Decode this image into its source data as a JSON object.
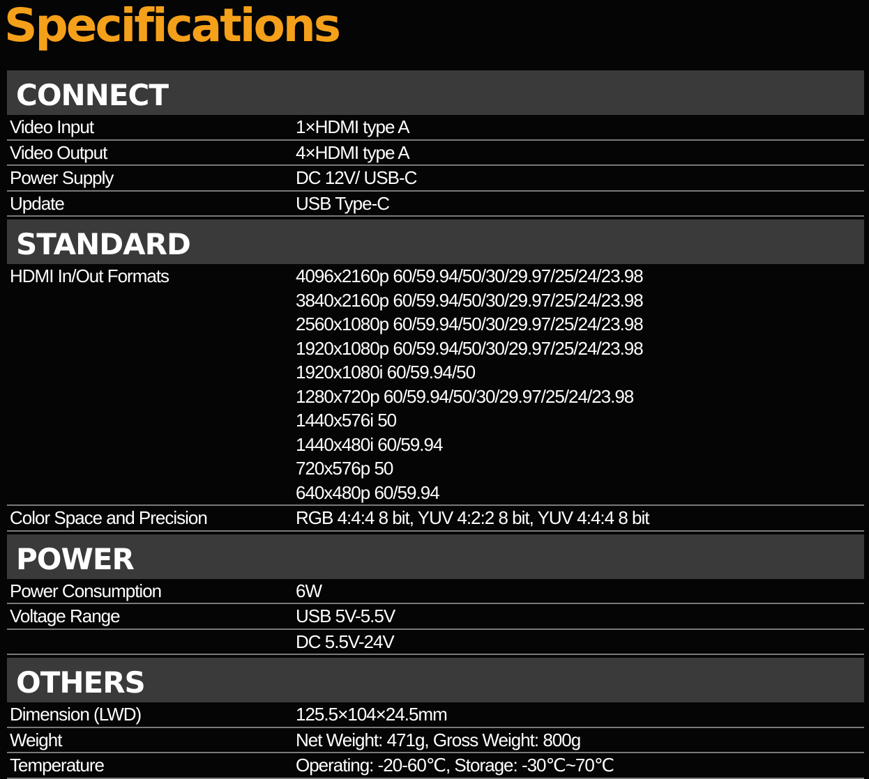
{
  "page": {
    "title": "Specifications",
    "accent_color": "#f5a01a",
    "header_bg": "#3a3a3a",
    "background": "#050505"
  },
  "sections": [
    {
      "title": "CONNECT",
      "rows": [
        {
          "label": "Video Input",
          "values": [
            "1×HDMI type A"
          ]
        },
        {
          "label": "Video Output",
          "values": [
            "4×HDMI type A"
          ]
        },
        {
          "label": "Power Supply",
          "values": [
            "DC 12V/ USB-C"
          ]
        },
        {
          "label": "Update",
          "values": [
            "USB Type-C"
          ]
        }
      ]
    },
    {
      "title": "STANDARD",
      "rows": [
        {
          "label": "HDMI In/Out Formats",
          "values": [
            "4096x2160p 60/59.94/50/30/29.97/25/24/23.98",
            "3840x2160p 60/59.94/50/30/29.97/25/24/23.98",
            "2560x1080p 60/59.94/50/30/29.97/25/24/23.98",
            "1920x1080p 60/59.94/50/30/29.97/25/24/23.98",
            "1920x1080i 60/59.94/50",
            "1280x720p 60/59.94/50/30/29.97/25/24/23.98",
            "1440x576i 50",
            "1440x480i 60/59.94",
            "720x576p 50",
            "640x480p 60/59.94"
          ]
        },
        {
          "label": "Color Space and Precision",
          "values": [
            "RGB 4:4:4 8 bit, YUV 4:2:2 8 bit, YUV 4:4:4 8 bit"
          ]
        }
      ]
    },
    {
      "title": "POWER",
      "rows": [
        {
          "label": "Power Consumption",
          "values": [
            "6W"
          ]
        },
        {
          "label": "Voltage Range",
          "values": [
            "USB 5V-5.5V"
          ]
        },
        {
          "label": "",
          "values": [
            "DC 5.5V-24V"
          ]
        }
      ]
    },
    {
      "title": "OTHERS",
      "rows": [
        {
          "label": "Dimension (LWD)",
          "values": [
            "125.5×104×24.5mm"
          ]
        },
        {
          "label": "Weight",
          "values": [
            "Net Weight: 471g, Gross Weight: 800g"
          ]
        },
        {
          "label": "Temperature",
          "values": [
            "Operating: -20-60℃, Storage: -30℃~70℃"
          ]
        }
      ]
    }
  ]
}
